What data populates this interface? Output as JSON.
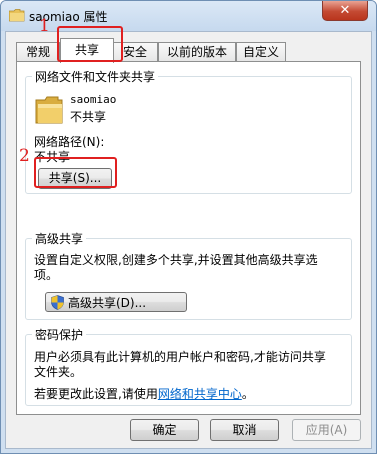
{
  "window": {
    "title": "saomiao 属性",
    "close_glyph": "✕"
  },
  "tabs": [
    {
      "label": "常规"
    },
    {
      "label": "共享"
    },
    {
      "label": "安全"
    },
    {
      "label": "以前的版本"
    },
    {
      "label": "自定义"
    }
  ],
  "network_sharing": {
    "group_title": "网络文件和文件夹共享",
    "folder_icon": "folder-icon",
    "folder_name": "saomiao",
    "folder_status": "不共享",
    "path_label": "网络路径(N):",
    "path_value": "不共享",
    "share_button": "共享(S)..."
  },
  "advanced_sharing": {
    "group_title": "高级共享",
    "description_line1": "设置自定义权限,创建多个共享,并设置其他高级共享选",
    "description_line2": "项。",
    "shield_icon": "uac-shield-icon",
    "button": "高级共享(D)..."
  },
  "password_protection": {
    "group_title": "密码保护",
    "description_line1": "用户必须具有此计算机的用户帐户和密码,才能访问共享",
    "description_line2": "文件夹。",
    "change_prefix": "若要更改此设置,请使用",
    "change_link": "网络和共享中心",
    "change_suffix": "。"
  },
  "footer": {
    "ok": "确定",
    "cancel": "取消",
    "apply": "应用(A)"
  },
  "annotations": {
    "step1": "1",
    "step2": "2",
    "color": "#e02020"
  }
}
